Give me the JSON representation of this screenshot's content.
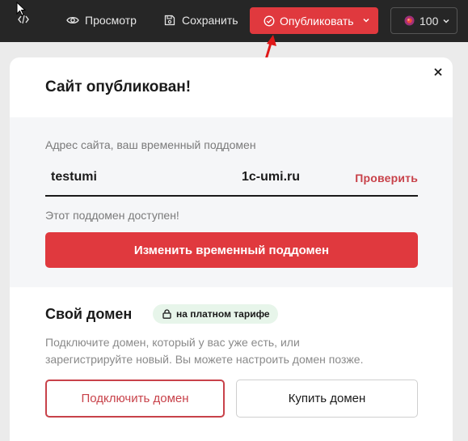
{
  "toolbar": {
    "preview_label": "Просмотр",
    "save_label": "Сохранить",
    "publish_label": "Опубликовать",
    "zoom_value": "100"
  },
  "colors": {
    "accent": "#e0393e",
    "toolbar_bg": "#262626",
    "link": "#c8424a",
    "badge_bg": "#e7f5ea"
  },
  "icons": [
    "code-icon",
    "eye-icon",
    "floppy-icon",
    "check-circle-icon",
    "chevron-down-icon",
    "color-ball-icon",
    "close-icon",
    "lock-icon",
    "cursor-icon",
    "arrow-annotation"
  ],
  "dialog": {
    "title": "Сайт опубликован!",
    "address_label": "Адрес сайта, ваш временный поддомен",
    "subdomain": "testumi",
    "domain_suffix": "1c-umi.ru",
    "check_link": "Проверить",
    "availability": "Этот поддомен доступен!",
    "change_button": "Изменить временный поддомен",
    "own_domain": {
      "title": "Свой домен",
      "badge": "на платном тарифе",
      "description_line1": "Подключите домен, который у вас уже есть, или",
      "description_line2": "зарегистрируйте новый. Вы можете настроить домен позже.",
      "connect_button": "Подключить домен",
      "buy_button": "Купить домен"
    }
  }
}
